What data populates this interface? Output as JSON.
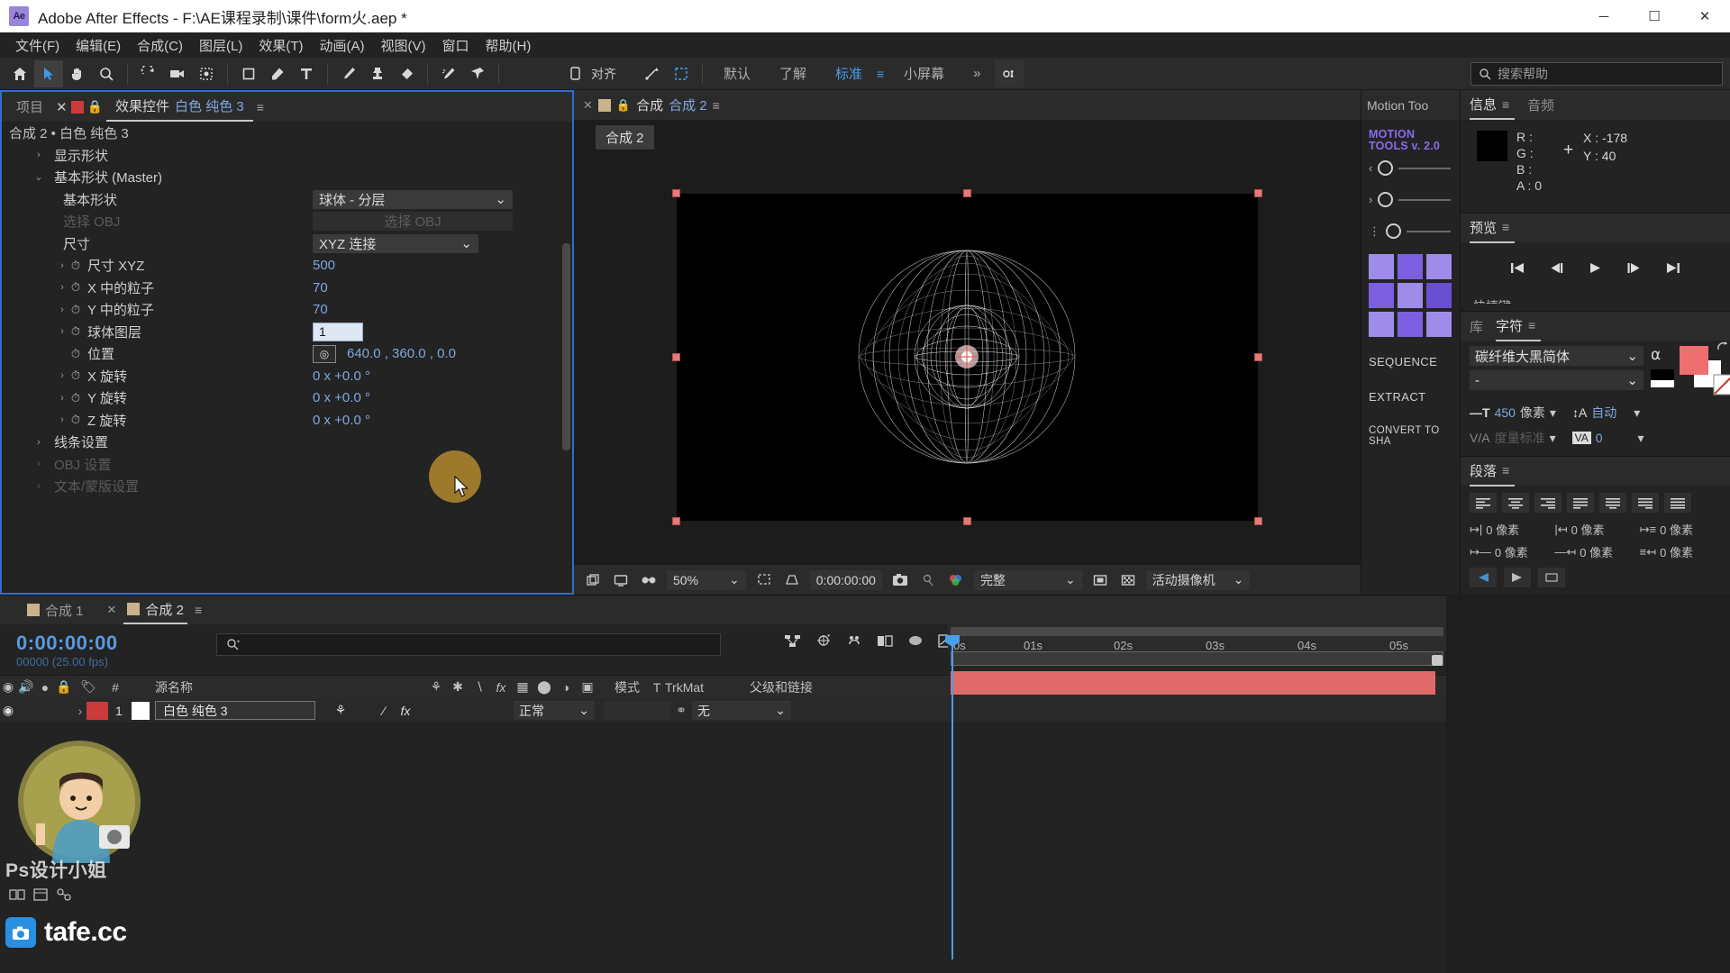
{
  "window": {
    "app_icon": "Ae",
    "title": "Adobe After Effects - F:\\AE课程录制\\课件\\form火.aep *",
    "minimize": "─",
    "maximize": "☐",
    "close": "✕"
  },
  "menubar": {
    "items": [
      "文件(F)",
      "编辑(E)",
      "合成(C)",
      "图层(L)",
      "效果(T)",
      "动画(A)",
      "视图(V)",
      "窗口",
      "帮助(H)"
    ]
  },
  "toolbar": {
    "tools": [
      {
        "name": "home-icon",
        "label": ""
      },
      {
        "name": "selection-tool-icon",
        "label": ""
      },
      {
        "name": "hand-tool-icon",
        "label": ""
      },
      {
        "name": "zoom-tool-icon",
        "label": ""
      },
      {
        "name": "rotation-tool-icon",
        "label": ""
      },
      {
        "name": "camera-tool-icon",
        "label": ""
      },
      {
        "name": "pan-behind-tool-icon",
        "label": ""
      },
      {
        "name": "shape-tool-icon",
        "label": ""
      },
      {
        "name": "pen-tool-icon",
        "label": ""
      },
      {
        "name": "type-tool-icon",
        "label": ""
      },
      {
        "name": "brush-tool-icon",
        "label": ""
      },
      {
        "name": "clone-stamp-tool-icon",
        "label": ""
      },
      {
        "name": "eraser-tool-icon",
        "label": ""
      },
      {
        "name": "roto-brush-tool-icon",
        "label": ""
      },
      {
        "name": "puppet-pin-tool-icon",
        "label": ""
      }
    ],
    "snapping_label": "对齐",
    "workspaces": [
      "默认",
      "了解",
      "标准",
      "小屏幕"
    ],
    "active_workspace": "标准",
    "overflow": "»",
    "search_placeholder": "搜索帮助"
  },
  "effect_controls": {
    "tabs": [
      {
        "label": "项目",
        "active": false
      },
      {
        "label": "效果控件",
        "active": true,
        "layer_name": "白色 纯色 3"
      }
    ],
    "breadcrumb": "合成 2 • 白色 纯色 3",
    "rows": [
      {
        "indent": 1,
        "arrow": "›",
        "stopwatch": false,
        "name": "显示形状",
        "value": "",
        "type": "group"
      },
      {
        "indent": 1,
        "arrow": "⌄",
        "stopwatch": false,
        "name": "基本形状 (Master)",
        "value": "",
        "type": "group"
      },
      {
        "indent": 2,
        "arrow": "",
        "stopwatch": false,
        "name": "基本形状",
        "value": "球体 - 分层",
        "type": "dropdown"
      },
      {
        "indent": 2,
        "arrow": "",
        "stopwatch": false,
        "name": "选择 OBJ",
        "value": "选择 OBJ",
        "type": "dropdown-disabled"
      },
      {
        "indent": 2,
        "arrow": "",
        "stopwatch": false,
        "name": "尺寸",
        "value": "XYZ 连接",
        "type": "dropdown-narrow"
      },
      {
        "indent": 2,
        "arrow": "›",
        "stopwatch": true,
        "name": "尺寸 XYZ",
        "value": "500",
        "type": "number"
      },
      {
        "indent": 2,
        "arrow": "›",
        "stopwatch": true,
        "name": "X 中的粒子",
        "value": "70",
        "type": "number"
      },
      {
        "indent": 2,
        "arrow": "›",
        "stopwatch": true,
        "name": "Y 中的粒子",
        "value": "70",
        "type": "number"
      },
      {
        "indent": 2,
        "arrow": "›",
        "stopwatch": true,
        "name": "球体图层",
        "value": "1",
        "type": "text-input"
      },
      {
        "indent": 2,
        "arrow": "",
        "stopwatch": true,
        "name": "位置",
        "value": "640.0 , 360.0 , 0.0",
        "type": "position"
      },
      {
        "indent": 2,
        "arrow": "›",
        "stopwatch": true,
        "name": "X 旋转",
        "value": "0 x +0.0 °",
        "type": "number"
      },
      {
        "indent": 2,
        "arrow": "›",
        "stopwatch": true,
        "name": "Y 旋转",
        "value": "0 x +0.0 °",
        "type": "number"
      },
      {
        "indent": 2,
        "arrow": "›",
        "stopwatch": true,
        "name": "Z 旋转",
        "value": "0 x +0.0 °",
        "type": "number"
      },
      {
        "indent": 1,
        "arrow": "›",
        "stopwatch": false,
        "name": "线条设置",
        "value": "",
        "type": "group"
      },
      {
        "indent": 1,
        "arrow": "›",
        "stopwatch": false,
        "name": "OBJ 设置",
        "value": "",
        "type": "group-dim"
      },
      {
        "indent": 1,
        "arrow": "›",
        "stopwatch": false,
        "name": "文本/蒙版设置",
        "value": "",
        "type": "group-dim"
      }
    ]
  },
  "composition": {
    "tab_label": "合成",
    "tab_name": "合成 2",
    "name_badge": "合成 2",
    "bottom_bar": {
      "zoom": "50%",
      "timecode": "0:00:00:00",
      "quality": "完整",
      "view": "活动摄像机"
    }
  },
  "motion_tools": {
    "tab_label": "Motion Too",
    "logo_line1": "MOTION",
    "logo_line2": "TOOLS v. 2.0",
    "buttons": [
      "SEQUENCE",
      "EXTRACT",
      "CONVERT TO SHA"
    ]
  },
  "info_panel": {
    "tabs": [
      {
        "label": "信息",
        "active": true
      },
      {
        "label": "音频",
        "active": false
      }
    ],
    "r_label": "R :",
    "g_label": "G :",
    "b_label": "B :",
    "a_label": "A : 0",
    "r": "",
    "g": "",
    "b": "",
    "x": "X : -178",
    "y": "Y : 40"
  },
  "preview_panel": {
    "title": "预览",
    "partial_label": "快捷键",
    "controls": [
      "first-frame",
      "prev-frame",
      "play",
      "next-frame",
      "last-frame"
    ]
  },
  "character_panel": {
    "tabs": [
      {
        "label": "库",
        "active": false
      },
      {
        "label": "字符",
        "active": true
      }
    ],
    "font_family": "碳纤维大黑简体",
    "font_style": "-",
    "font_size": "450",
    "font_size_unit": "像素",
    "leading": "自动",
    "kerning": "度量标准",
    "tracking": "0"
  },
  "paragraph_panel": {
    "title": "段落",
    "values": [
      "0 像素",
      "0 像素",
      "0 像素",
      "0 像素",
      "0 像素",
      "0 像素"
    ]
  },
  "timeline": {
    "tabs": [
      {
        "label": "合成 1",
        "active": false
      },
      {
        "label": "合成 2",
        "active": true
      }
    ],
    "timecode": "0:00:00:00",
    "frame_info": "00000 (25.00 fps)",
    "search_placeholder": "",
    "columns": [
      "#",
      "源名称",
      "模式",
      "T",
      "TrkMat",
      "父级和链接"
    ],
    "layers": [
      {
        "index": "1",
        "source_name": "白色 纯色 3",
        "mode": "正常",
        "trkmat": "",
        "parent": "无",
        "color": "#cc3b3b"
      }
    ],
    "ruler_ticks": [
      "0s",
      "01s",
      "02s",
      "03s",
      "04s",
      "05s"
    ]
  },
  "watermark": {
    "text": "Ps设计小姐",
    "brand_icon": "camera-icon",
    "brand_text": "tafe.cc"
  },
  "colors": {
    "accent_blue": "#4a9eea",
    "value_blue": "#7fa8e0",
    "panel_bg": "#232323",
    "tab_bg": "#2b2b2b",
    "layer_red": "#e06a6a",
    "solid_red": "#cc3b3b",
    "motion_purple": "#7b5fe0",
    "swatch_red": "#ef6e6e"
  }
}
